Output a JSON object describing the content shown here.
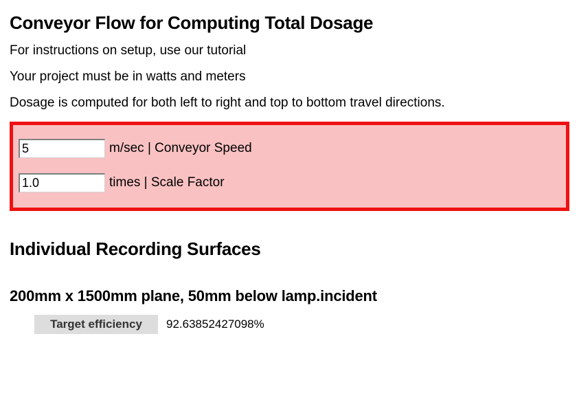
{
  "heading_main": "Conveyor Flow for Computing Total Dosage",
  "intro": {
    "line1": "For instructions on setup, use our tutorial",
    "line2": "Your project must be in watts and meters",
    "line3": "Dosage is computed for both left to right and top to bottom travel directions."
  },
  "form": {
    "speed": {
      "value": "5",
      "label": "m/sec | Conveyor Speed"
    },
    "scale": {
      "value": "1.0",
      "label": "times | Scale Factor"
    }
  },
  "heading_surfaces": "Individual Recording Surfaces",
  "surface1": {
    "title": "200mm x 1500mm plane, 50mm below lamp.incident",
    "row1_key": "Target efficiency",
    "row1_val": "92.63852427098%"
  }
}
